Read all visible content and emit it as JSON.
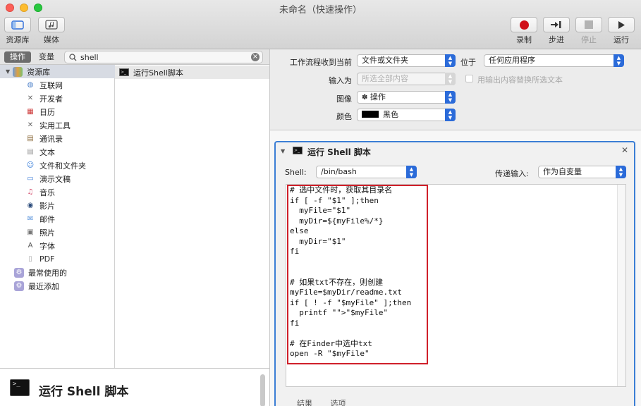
{
  "window": {
    "title": "未命名（快速操作）"
  },
  "toolbar": {
    "library": "资源库",
    "media": "媒体",
    "record": "录制",
    "step": "步进",
    "stop": "停止",
    "run": "运行",
    "colors": {
      "record": "#d0101a",
      "accent": "#2b6bd9"
    }
  },
  "left": {
    "tabs": {
      "actions": "操作",
      "variables": "变量"
    },
    "search": {
      "value": "shell"
    },
    "library_root": "资源库",
    "library_items": [
      {
        "label": "互联网",
        "icon": "globe-icon"
      },
      {
        "label": "开发者",
        "icon": "tools-icon"
      },
      {
        "label": "日历",
        "icon": "calendar-icon"
      },
      {
        "label": "实用工具",
        "icon": "tools-icon"
      },
      {
        "label": "通讯录",
        "icon": "contacts-icon"
      },
      {
        "label": "文本",
        "icon": "text-icon"
      },
      {
        "label": "文件和文件夹",
        "icon": "finder-icon"
      },
      {
        "label": "演示文稿",
        "icon": "presentation-icon"
      },
      {
        "label": "音乐",
        "icon": "music-icon"
      },
      {
        "label": "影片",
        "icon": "movie-icon"
      },
      {
        "label": "邮件",
        "icon": "mail-icon"
      },
      {
        "label": "照片",
        "icon": "photos-icon"
      },
      {
        "label": "字体",
        "icon": "font-icon"
      },
      {
        "label": "PDF",
        "icon": "pdf-icon"
      }
    ],
    "smart_groups": [
      "最常使用的",
      "最近添加"
    ],
    "action_result": "运行Shell脚本",
    "description_title": "运行 Shell 脚本"
  },
  "workflow": {
    "receives_label": "工作流程收到当前",
    "receives_value": "文件或文件夹",
    "in_label": "位于",
    "in_value": "任何应用程序",
    "input_label": "输入为",
    "input_value": "所选全部内容",
    "replace_label": "用输出内容替换所选文本",
    "image_label": "图像",
    "image_value": "操作",
    "color_label": "颜色",
    "color_value": "黑色"
  },
  "action": {
    "title": "运行 Shell 脚本",
    "shell_label": "Shell:",
    "shell_value": "/bin/bash",
    "pass_label": "传递输入:",
    "pass_value": "作为自变量",
    "code": [
      "# 选中文件时，获取其目录名",
      "if [ -f \"$1\" ];then",
      "  myFile=\"$1\"",
      "  myDir=${myFile%/*}",
      "else",
      "  myDir=\"$1\"",
      "fi",
      "",
      "",
      "# 如果txt不存在，则创建",
      "myFile=$myDir/readme.txt",
      "if [ ! -f \"$myFile\" ];then",
      "  printf \"\">\"$myFile\"",
      "fi",
      "",
      "# 在Finder中选中txt",
      "open -R \"$myFile\""
    ],
    "tabs": {
      "results": "结果",
      "options": "选项"
    }
  }
}
